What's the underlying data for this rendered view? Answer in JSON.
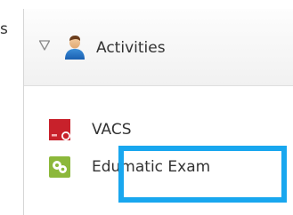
{
  "partial_left_text": "s",
  "activities_header": {
    "label": "Activities",
    "toggle_icon": "triangle-down-outline-icon",
    "person_icon": "person-icon"
  },
  "items": [
    {
      "label": "VACS",
      "icon": "vacs-logo-icon",
      "icon_color": "#c8212b"
    },
    {
      "label": "Edumatic Exam",
      "icon": "edumatic-logo-icon",
      "icon_color": "#8cb83b"
    }
  ],
  "selection": {
    "color": "#19a7ef",
    "target": "Edumatic Exam"
  }
}
